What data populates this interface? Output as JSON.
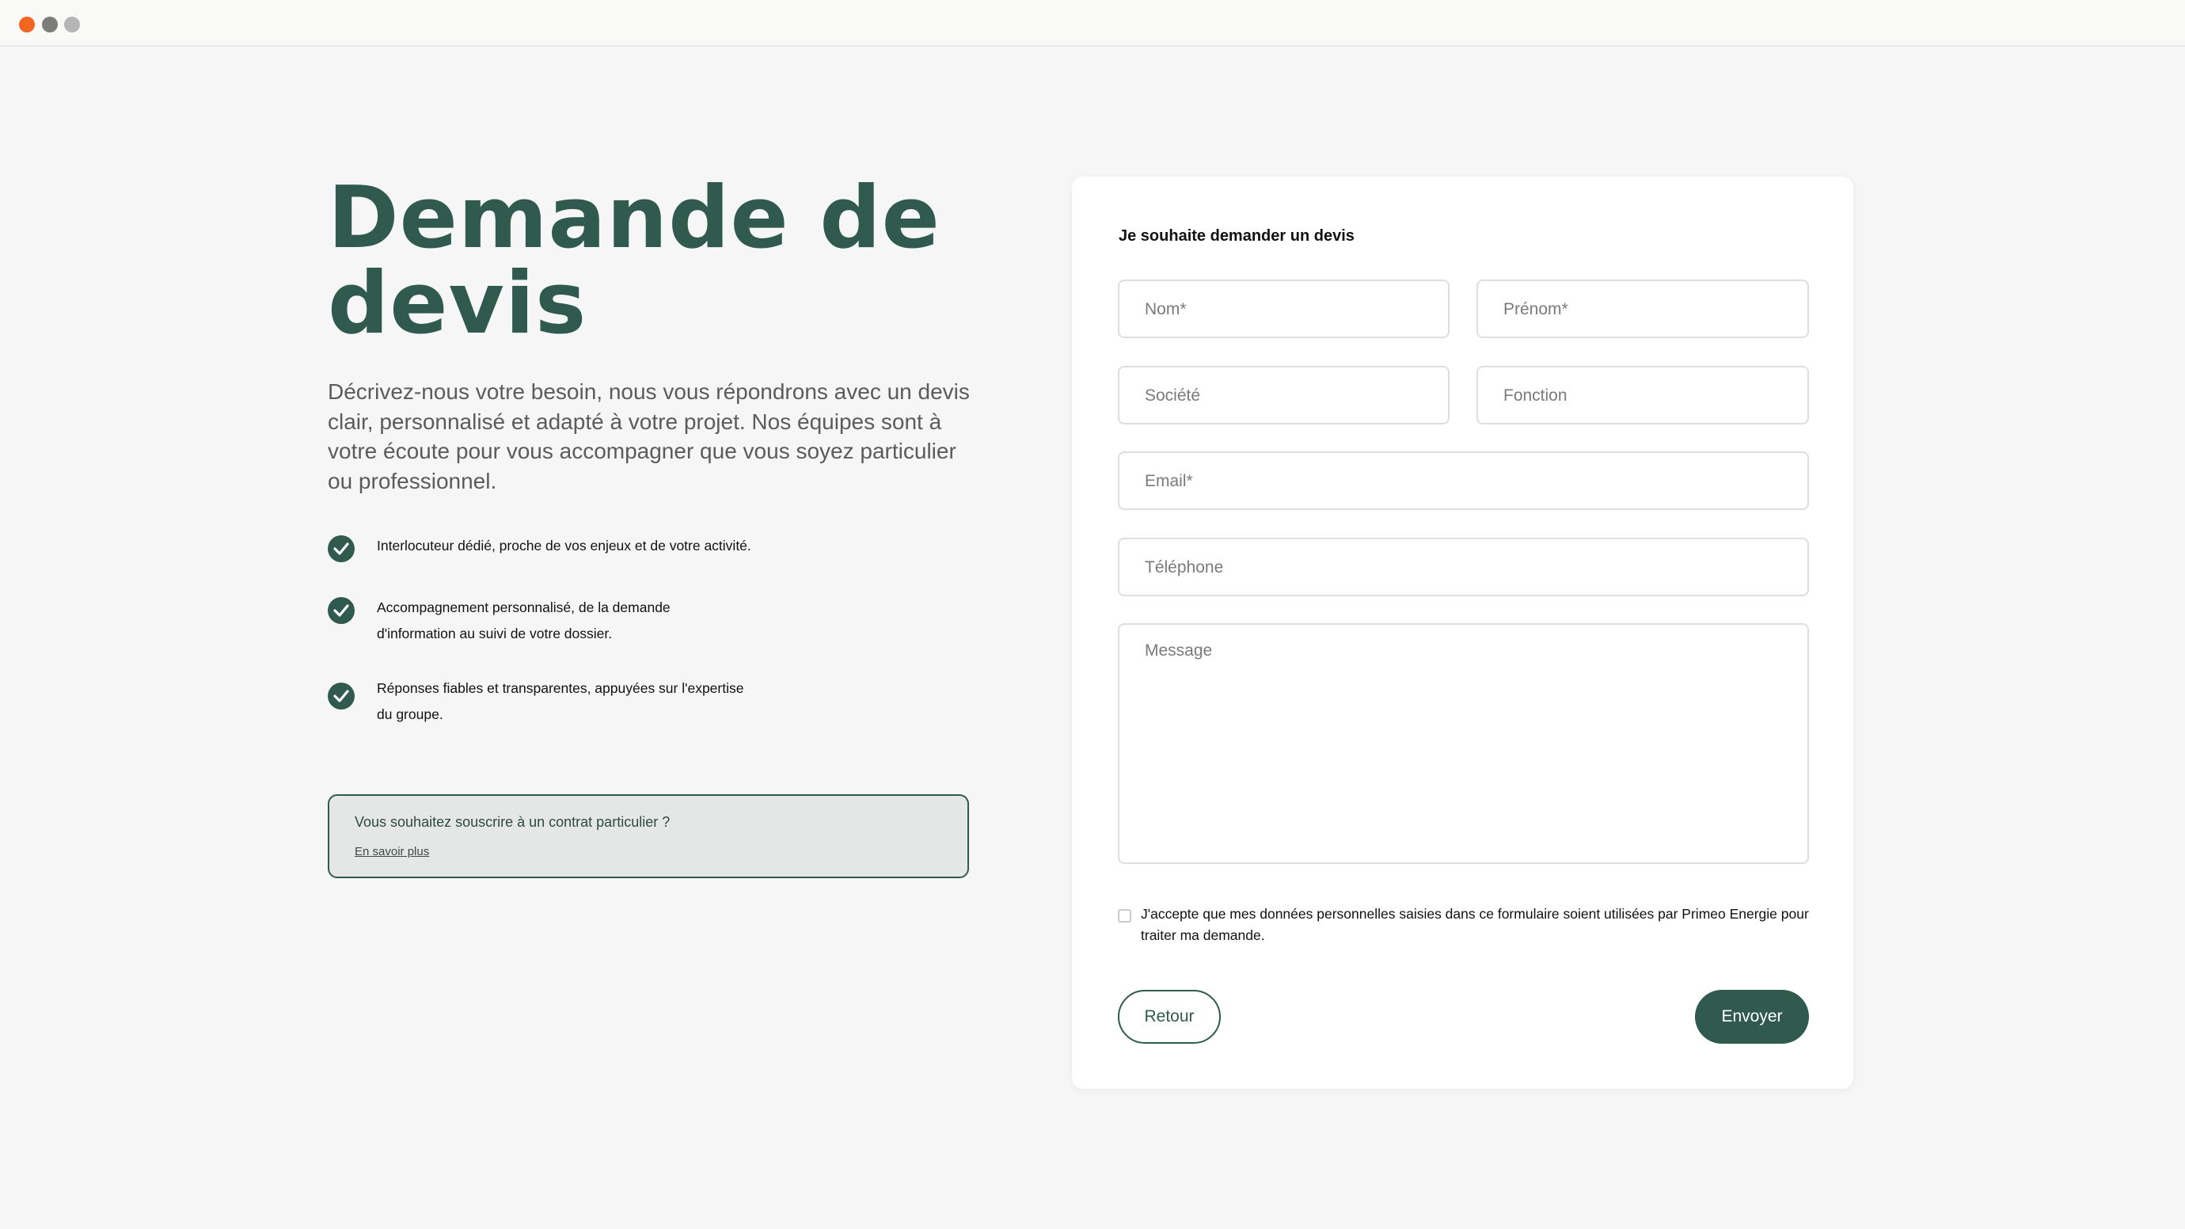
{
  "window": {
    "controls": [
      "close-dot",
      "minimize-dot",
      "zoom-dot"
    ]
  },
  "hero": {
    "title": "Demande de devis",
    "description": "Décrivez-nous votre besoin, nous vous répondrons avec un devis clair, personnalisé et adapté à votre projet. Nos équipes sont à votre écoute pour vous accompagner que vous soyez particulier ou professionnel."
  },
  "benefits": [
    {
      "line1": "Interlocuteur dédié, proche de vos enjeux et de votre activité.",
      "line2": ""
    },
    {
      "line1": "Accompagnement personnalisé, de la demande",
      "line2": "d'information au suivi de votre dossier."
    },
    {
      "line1": "Réponses fiables et transparentes, appuyées sur l'expertise",
      "line2": "du groupe."
    }
  ],
  "notice": {
    "title": "Vous souhaitez souscrire à un contrat particulier ?",
    "link": "En savoir plus"
  },
  "form": {
    "heading": "Je souhaite demander un devis",
    "fields": {
      "nom": {
        "placeholder": "Nom*",
        "value": ""
      },
      "prenom": {
        "placeholder": "Prénom*",
        "value": ""
      },
      "societe": {
        "placeholder": "Société",
        "value": ""
      },
      "fonction": {
        "placeholder": "Fonction",
        "value": ""
      },
      "email": {
        "placeholder": "Email*",
        "value": ""
      },
      "telephone": {
        "placeholder": "Téléphone",
        "value": ""
      },
      "message": {
        "placeholder": "Message",
        "value": ""
      }
    },
    "consent": {
      "checked": false,
      "text": "J'accepte que mes données personnelles saisies dans ce formulaire soient utilisées par Primeo Energie pour traiter ma demande."
    },
    "back_label": "Retour",
    "submit_label": "Envoyer"
  },
  "colors": {
    "brand_green": "#2f5a4d",
    "page_bg": "#f6f6f7",
    "close_dot": "#f26522"
  }
}
